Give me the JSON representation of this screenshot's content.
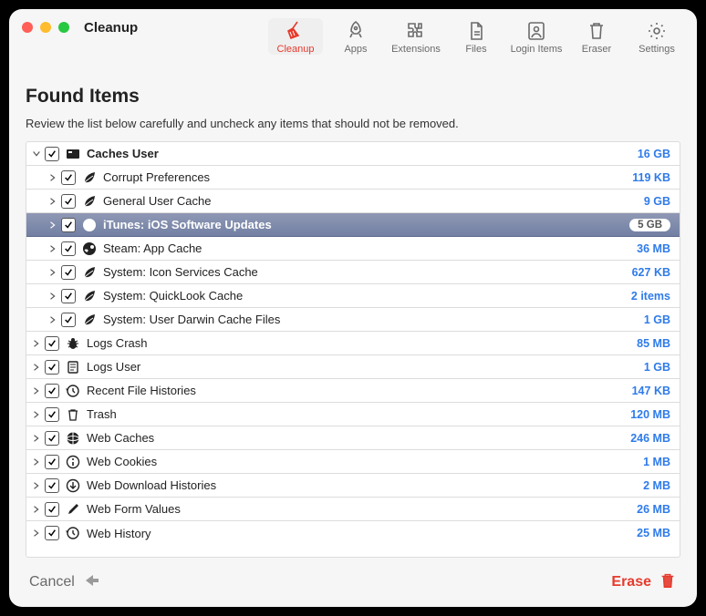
{
  "window": {
    "title": "Cleanup"
  },
  "toolbar": {
    "items": [
      {
        "label": "Cleanup",
        "icon": "broom-icon",
        "active": true
      },
      {
        "label": "Apps",
        "icon": "rocket-icon",
        "active": false
      },
      {
        "label": "Extensions",
        "icon": "puzzle-icon",
        "active": false
      },
      {
        "label": "Files",
        "icon": "file-icon",
        "active": false
      },
      {
        "label": "Login Items",
        "icon": "login-icon",
        "active": false
      },
      {
        "label": "Eraser",
        "icon": "trash-icon",
        "active": false
      },
      {
        "label": "Settings",
        "icon": "gear-icon",
        "active": false
      }
    ]
  },
  "page": {
    "heading": "Found Items",
    "description": "Review the list below carefully and uncheck any items that should not be removed."
  },
  "items": [
    {
      "depth": 0,
      "expanded": true,
      "checked": true,
      "icon": "drive-icon",
      "name": "Caches User",
      "size": "16 GB",
      "selected": false,
      "top": true
    },
    {
      "depth": 1,
      "expanded": false,
      "checked": true,
      "icon": "leaf-icon",
      "name": "Corrupt Preferences",
      "size": "119 KB",
      "selected": false
    },
    {
      "depth": 1,
      "expanded": false,
      "checked": true,
      "icon": "leaf-icon",
      "name": "General User Cache",
      "size": "9 GB",
      "selected": false
    },
    {
      "depth": 1,
      "expanded": false,
      "checked": true,
      "icon": "appstore-icon",
      "name": "iTunes: iOS Software Updates",
      "size": "5 GB",
      "selected": true
    },
    {
      "depth": 1,
      "expanded": false,
      "checked": true,
      "icon": "steam-icon",
      "name": "Steam: App Cache",
      "size": "36 MB",
      "selected": false
    },
    {
      "depth": 1,
      "expanded": false,
      "checked": true,
      "icon": "leaf-icon",
      "name": "System: Icon Services Cache",
      "size": "627 KB",
      "selected": false
    },
    {
      "depth": 1,
      "expanded": false,
      "checked": true,
      "icon": "leaf-icon",
      "name": "System: QuickLook Cache",
      "size": "2 items",
      "selected": false
    },
    {
      "depth": 1,
      "expanded": false,
      "checked": true,
      "icon": "leaf-icon",
      "name": "System: User Darwin Cache Files",
      "size": "1 GB",
      "selected": false
    },
    {
      "depth": 0,
      "expanded": false,
      "checked": true,
      "icon": "bug-icon",
      "name": "Logs Crash",
      "size": "85 MB",
      "selected": false
    },
    {
      "depth": 0,
      "expanded": false,
      "checked": true,
      "icon": "page-icon",
      "name": "Logs User",
      "size": "1 GB",
      "selected": false
    },
    {
      "depth": 0,
      "expanded": false,
      "checked": true,
      "icon": "history-icon",
      "name": "Recent File Histories",
      "size": "147 KB",
      "selected": false
    },
    {
      "depth": 0,
      "expanded": false,
      "checked": true,
      "icon": "trash-row-icon",
      "name": "Trash",
      "size": "120 MB",
      "selected": false
    },
    {
      "depth": 0,
      "expanded": false,
      "checked": true,
      "icon": "globe-icon",
      "name": "Web Caches",
      "size": "246 MB",
      "selected": false
    },
    {
      "depth": 0,
      "expanded": false,
      "checked": true,
      "icon": "info-icon",
      "name": "Web Cookies",
      "size": "1 MB",
      "selected": false
    },
    {
      "depth": 0,
      "expanded": false,
      "checked": true,
      "icon": "download-icon",
      "name": "Web Download Histories",
      "size": "2 MB",
      "selected": false
    },
    {
      "depth": 0,
      "expanded": false,
      "checked": true,
      "icon": "pencil-icon",
      "name": "Web Form Values",
      "size": "26 MB",
      "selected": false
    },
    {
      "depth": 0,
      "expanded": false,
      "checked": true,
      "icon": "history-icon",
      "name": "Web History",
      "size": "25 MB",
      "selected": false
    }
  ],
  "footer": {
    "cancel": "Cancel",
    "erase": "Erase"
  }
}
